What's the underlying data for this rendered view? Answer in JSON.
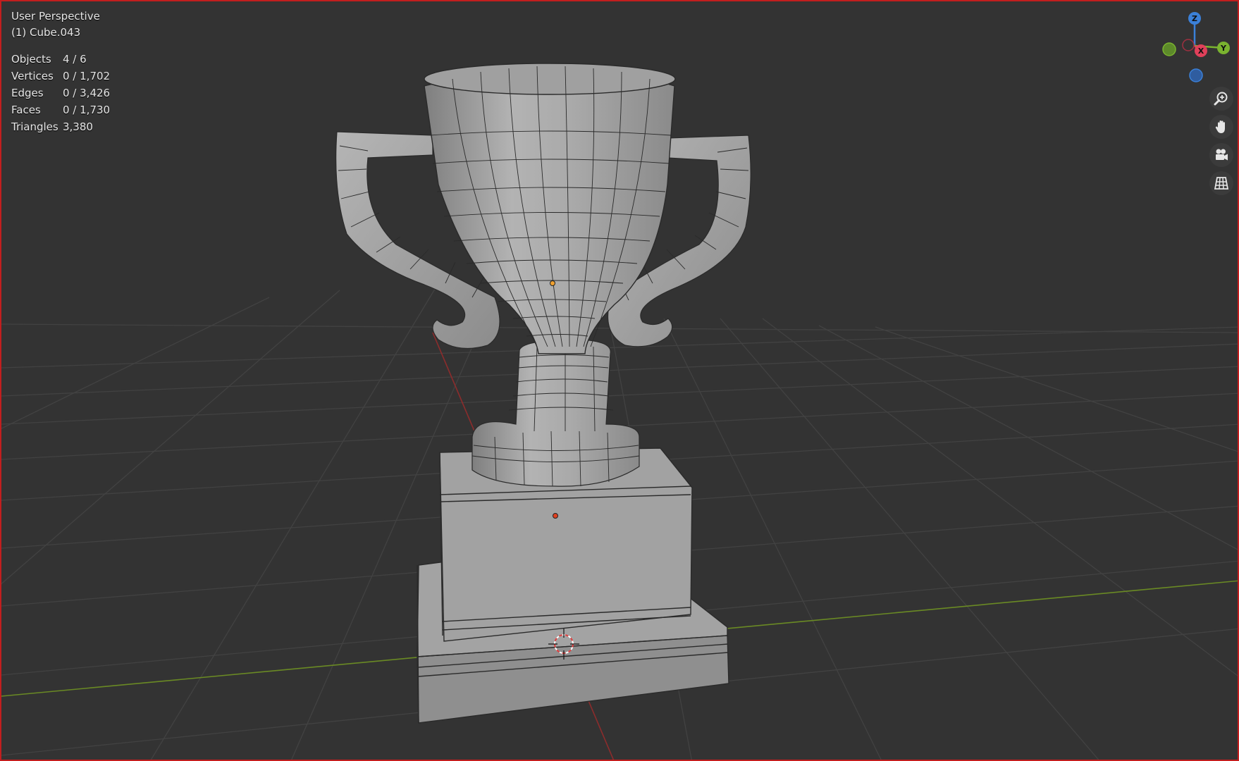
{
  "header": {
    "view_mode": "User Perspective",
    "active_object": "(1) Cube.043"
  },
  "stats": [
    {
      "key": "Objects",
      "value": "4 / 6"
    },
    {
      "key": "Vertices",
      "value": "0 / 1,702"
    },
    {
      "key": "Edges",
      "value": "0 / 3,426"
    },
    {
      "key": "Faces",
      "value": "0 / 1,730"
    },
    {
      "key": "Triangles",
      "value": "3,380"
    }
  ],
  "gizmo": {
    "z_label": "Z",
    "x_label": "X",
    "y_label": "Y",
    "colors": {
      "x": "#e0405a",
      "y": "#7ab32f",
      "z": "#3b80d8"
    }
  },
  "nav_tools": [
    {
      "id": "zoom",
      "icon": "zoom-icon"
    },
    {
      "id": "pan",
      "icon": "hand-icon"
    },
    {
      "id": "camera",
      "icon": "camera-icon"
    },
    {
      "id": "ortho",
      "icon": "grid-icon"
    }
  ],
  "scene": {
    "object": "trophy",
    "grid_color": "#444444",
    "x_axis_color": "#8c2c2c",
    "y_axis_color": "#6a8a24",
    "mesh_color": "#a8a8a8",
    "wire_color": "#2a2a2a"
  }
}
